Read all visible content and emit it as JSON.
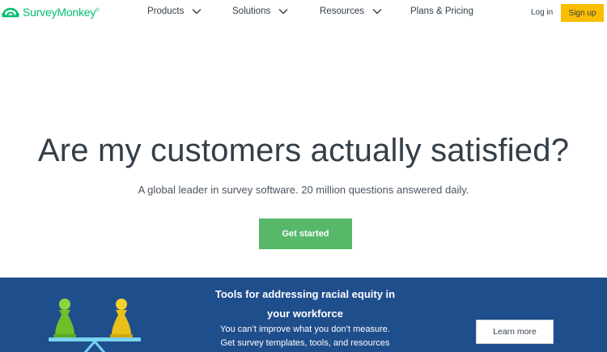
{
  "header": {
    "logo_text": "SurveyMonkey",
    "logo_mark": "®",
    "nav": [
      {
        "label": "Products",
        "has_dropdown": true
      },
      {
        "label": "Solutions",
        "has_dropdown": true
      },
      {
        "label": "Resources",
        "has_dropdown": true
      },
      {
        "label": "Plans & Pricing",
        "has_dropdown": false
      }
    ],
    "login_label": "Log in",
    "signup_label": "Sign up"
  },
  "hero": {
    "title": "Are my customers actually satisfied?",
    "subtitle": "A global leader in survey software. 20 million questions answered daily.",
    "cta_label": "Get started"
  },
  "banner": {
    "title": "Tools for addressing racial equity in your workforce",
    "body_line1": "You can’t improve what you don’t measure.",
    "body_line2": "Get survey templates, tools, and resources",
    "button_label": "Learn more"
  },
  "colors": {
    "brand_green": "#00bf6f",
    "cta_green": "#58b86a",
    "signup_yellow": "#f9be00",
    "banner_blue": "#1f4e8c",
    "text_dark": "#333e48"
  }
}
